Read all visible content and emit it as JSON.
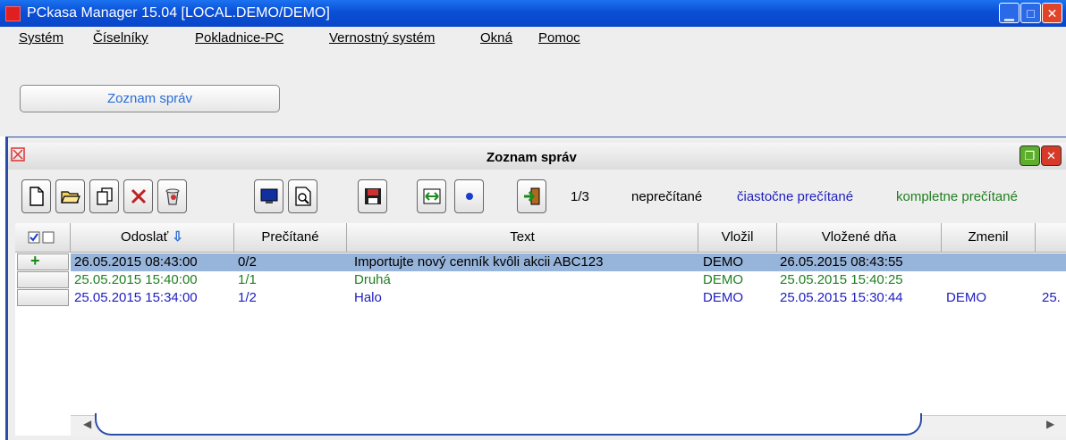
{
  "window": {
    "title": "PCkasa Manager 15.04 [LOCAL.DEMO/DEMO]"
  },
  "menu": [
    {
      "label": "Systém"
    },
    {
      "label": "Číselníky"
    },
    {
      "label": "Pokladnice-PC"
    },
    {
      "label": "Vernostný systém"
    },
    {
      "label": "Okná"
    },
    {
      "label": "Pomoc"
    }
  ],
  "tabbar": {
    "active_tab": "Zoznam správ"
  },
  "internal_window": {
    "title": "Zoznam správ"
  },
  "toolbar": {
    "page_counter": "1/3",
    "legend": {
      "unread": "neprečítané",
      "partial": "čiastočne prečítané",
      "full": "kompletne prečítané"
    },
    "colors": {
      "unread": "#000000",
      "partial": "#2020c0",
      "full": "#208020"
    }
  },
  "table": {
    "columns": [
      "Odoslať",
      "Prečítané",
      "Text",
      "Vložil",
      "Vložené dňa",
      "Zmenil"
    ],
    "rows": [
      {
        "odoslat": "26.05.2015 08:43:00",
        "precitane": "0/2",
        "text": "Importujte nový cenník kvôli akcii ABC123",
        "vlozil": "DEMO",
        "vlozene": "26.05.2015 08:43:55",
        "zmenil": "",
        "extra": ""
      },
      {
        "odoslat": "25.05.2015 15:40:00",
        "precitane": "1/1",
        "text": "Druhá",
        "vlozil": "DEMO",
        "vlozene": "25.05.2015 15:40:25",
        "zmenil": "",
        "extra": ""
      },
      {
        "odoslat": "25.05.2015 15:34:00",
        "precitane": "1/2",
        "text": "Halo",
        "vlozil": "DEMO",
        "vlozene": "25.05.2015 15:30:44",
        "zmenil": "DEMO",
        "extra": "25."
      }
    ],
    "selection_color": "#97b4da"
  }
}
